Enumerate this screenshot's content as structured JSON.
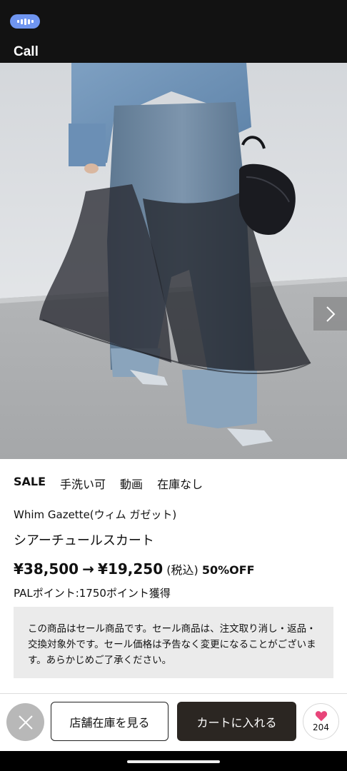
{
  "status_bar": {
    "call_pill_icon": "ongoing-call-icon",
    "call_label": "Call",
    "accent": "#6f95f0"
  },
  "product_image": {
    "next_icon": "chevron-right-icon"
  },
  "tags": [
    "SALE",
    "手洗い可",
    "動画",
    "在庫なし"
  ],
  "product": {
    "brand": "Whim Gazette(ウィム ガゼット)",
    "name": "シアーチュールスカート",
    "original_price": "¥38,500",
    "arrow": "→",
    "sale_price": "¥19,250",
    "tax_note": "(税込)",
    "discount": "50%OFF",
    "points": "PALポイント:1750ポイント獲得"
  },
  "notice": "この商品はセール商品です。セール商品は、注文取り消し・返品・交換対象外です。セール価格は予告なく変更になることがございます。あらかじめご了承ください。",
  "actions": {
    "close_icon": "close-icon",
    "store_stock_label": "店舗在庫を見る",
    "add_to_cart_label": "カートに入れる",
    "favorite_icon": "heart-icon",
    "favorite_count": "204",
    "favorite_color": "#e8457a",
    "cart_color": "#2b2622"
  }
}
